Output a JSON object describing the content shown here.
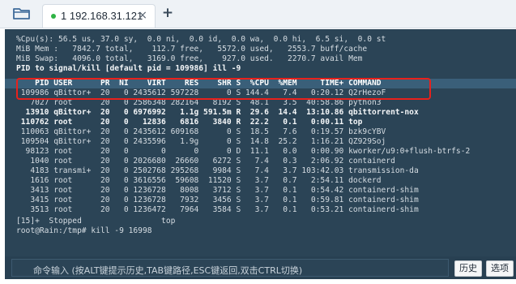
{
  "tabbar": {
    "tab": {
      "label": "1 192.168.31.121",
      "close": "×",
      "status_color": "#2fb344"
    },
    "new_tab": "+"
  },
  "terminal": {
    "lines": [
      "%Cpu(s): 56.5 us, 37.0 sy,  0.0 ni,  0.0 id,  0.0 wa,  0.0 hi,  6.5 si,  0.0 st",
      "MiB Mem :   7842.7 total,    112.7 free,   5572.0 used,   2553.7 buff/cache",
      "MiB Swap:   4096.0 total,   3169.0 free,    927.0 used.   2270.7 avail Mem",
      "PID to signal/kill [default pid = 109986] ill -9"
    ],
    "header": "    PID USER      PR  NI    VIRT    RES    SHR S  %CPU  %MEM     TIME+ COMMAND",
    "processes": [
      {
        "text": " 109986 qBittor+  20   0 2435612 597228      0 S 144.4   7.4   0:20.12 Q2rHezoF",
        "bold": false
      },
      {
        "text": "   7027 root      20   0 2586348 282164   8192 S  48.1   3.5  40:58.86 python3",
        "bold": false
      },
      {
        "text": "  13910 qBittor+  20   0 6976992   1.1g 591.5m R  29.6  14.4  13:10.86 qbittorrent-nox",
        "bold": true
      },
      {
        "text": " 110762 root      20   0   12836   6816   3840 R  22.2   0.1   0:00.11 top",
        "bold": true
      },
      {
        "text": " 110063 qBittor+  20   0 2435612 609168      0 S  18.5   7.6   0:19.57 bzk9cYBV",
        "bold": false
      },
      {
        "text": " 109504 qBittor+  20   0 2435596   1.9g      0 S  14.8  25.2   1:16.21 QZ929Soj",
        "bold": false
      },
      {
        "text": "  98123 root      20   0       0      0      0 D  11.1   0.0   0:00.90 kworker/u9:0+flush-btrfs-2",
        "bold": false
      },
      {
        "text": "   1040 root      20   0 2026680  26660   6272 S   7.4   0.3   2:06.92 containerd",
        "bold": false
      },
      {
        "text": "   4183 transmi+  20   0 2502768 295268   9984 S   7.4   3.7 103:42.03 transmission-da",
        "bold": false
      },
      {
        "text": "   1616 root      20   0 3616556  59608  11520 S   3.7   0.7   2:54.11 dockerd",
        "bold": false
      },
      {
        "text": "   3413 root      20   0 1236728   8008   3712 S   3.7   0.1   0:54.42 containerd-shim",
        "bold": false
      },
      {
        "text": "   3415 root      20   0 1236728   7932   3456 S   3.7   0.1   0:59.81 containerd-shim",
        "bold": false
      },
      {
        "text": "   3513 root      20   0 1236472   7964   3584 S   3.7   0.1   0:53.21 containerd-shim",
        "bold": false
      }
    ],
    "footer": [
      "[15]+  Stopped                 top",
      "root@Rain:/tmp# kill -9 16998"
    ],
    "colors": {
      "background": "#2b4456",
      "header_bar": "#3a5f79",
      "highlight": "#e8211c"
    }
  },
  "command_bar": {
    "placeholder": "命令输入 (按ALT键提示历史,TAB键路径,ESC键返回,双击CTRL切换)",
    "history_label": "历史",
    "options_label": "选项"
  }
}
